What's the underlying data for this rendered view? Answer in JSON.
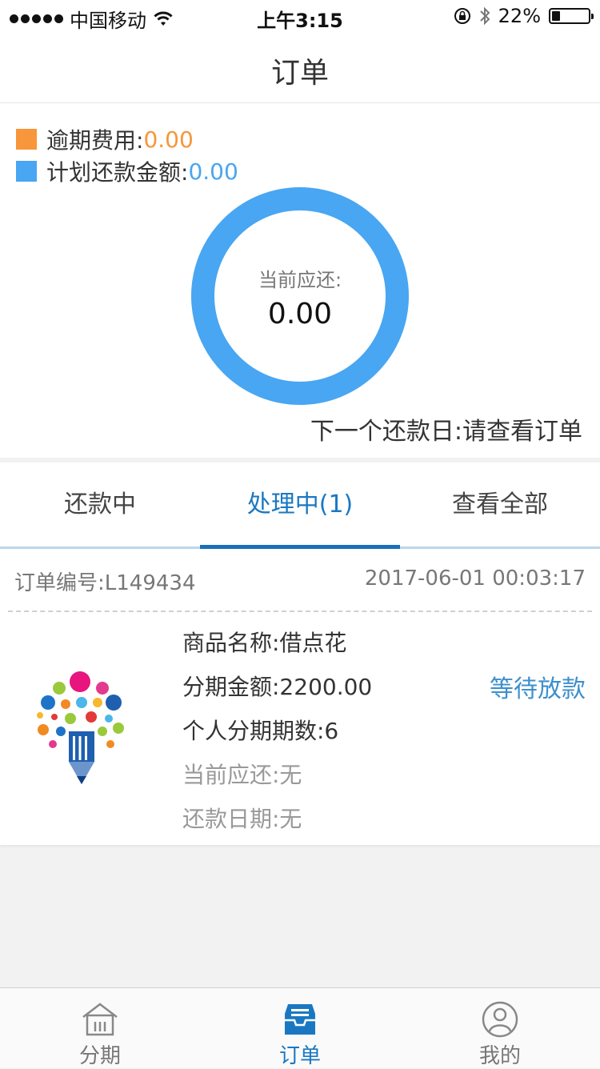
{
  "status_bar": {
    "carrier": "中国移动",
    "time": "上午3:15",
    "battery": "22%",
    "battery_level": 0.22
  },
  "header": {
    "title": "订单"
  },
  "summary": {
    "legend": [
      {
        "label": "逾期费用:",
        "value": "0.00",
        "color": "#f7963a"
      },
      {
        "label": "计划还款金额:",
        "value": "0.00",
        "color": "#48a6f2"
      }
    ],
    "donut_label": "当前应还:",
    "donut_value": "0.00",
    "donut_color": "#48a6f2",
    "next_repay": "下一个还款日:请查看订单"
  },
  "tabs": [
    {
      "label": "还款中"
    },
    {
      "label": "处理中(1)"
    },
    {
      "label": "查看全部"
    }
  ],
  "order": {
    "order_no": "订单编号:L149434",
    "time": "2017-06-01 00:03:17",
    "product": "商品名称:借点花",
    "amount": "分期金额:2200.00",
    "periods": "个人分期期数:6",
    "current_due": "当前应还:无",
    "repay_date": "还款日期:无",
    "status": "等待放款"
  },
  "tabbar": [
    {
      "label": "分期",
      "icon": "home-icon"
    },
    {
      "label": "订单",
      "icon": "inbox-icon"
    },
    {
      "label": "我的",
      "icon": "user-icon"
    }
  ],
  "colors": {
    "accent": "#1a78c2",
    "orange": "#f7963a",
    "blue": "#48a6f2"
  }
}
